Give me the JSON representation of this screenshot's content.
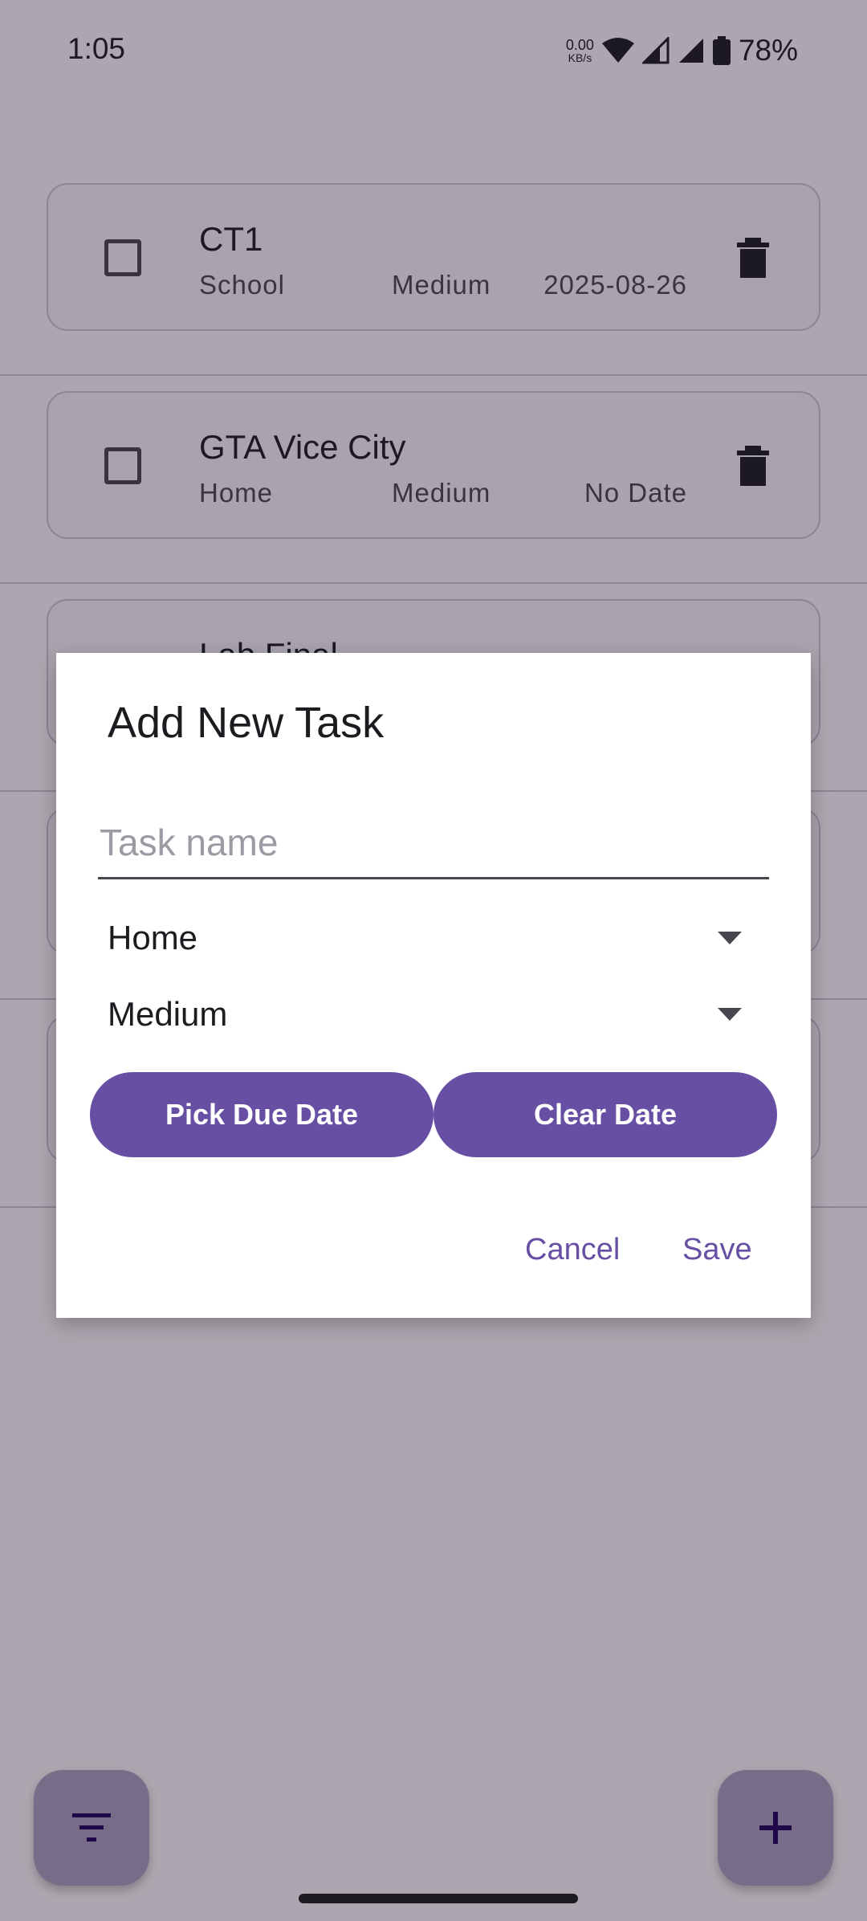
{
  "status_bar": {
    "time": "1:05",
    "net_speed_value": "0.00",
    "net_speed_unit": "KB/s",
    "battery": "78%"
  },
  "tasks": [
    {
      "title": "CT1",
      "category": "School",
      "priority": "Medium",
      "due": "2025-08-26",
      "done": false
    },
    {
      "title": "GTA Vice City",
      "category": "Home",
      "priority": "Medium",
      "due": "No Date",
      "done": false
    },
    {
      "title": "Lab Final",
      "category": "",
      "priority": "",
      "due": "",
      "done": false
    }
  ],
  "dialog": {
    "title": "Add New Task",
    "task_name_placeholder": "Task name",
    "task_name_value": "",
    "category_selected": "Home",
    "priority_selected": "Medium",
    "pick_date_label": "Pick Due Date",
    "clear_date_label": "Clear Date",
    "cancel_label": "Cancel",
    "save_label": "Save"
  },
  "fabs": {
    "filter_icon": "filter-list-icon",
    "add_icon": "plus-icon"
  },
  "colors": {
    "primary": "#6750a4",
    "fab_bg": "#ab9fc0",
    "scrim": "rgba(30,22,40,0.36)"
  }
}
